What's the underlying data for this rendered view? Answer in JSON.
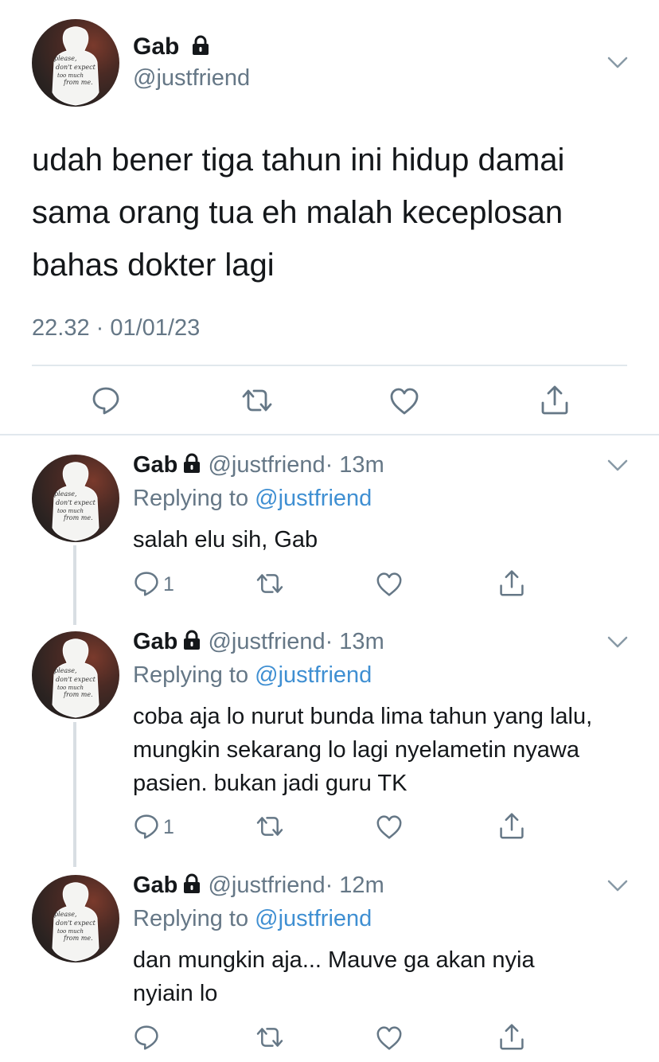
{
  "main_tweet": {
    "name": "Gab",
    "handle": "@justfriend",
    "text": "udah bener tiga tahun ini hidup damai sama orang tua eh malah keceplosan bahas dokter lagi",
    "timestamp": "22.32 · 01/01/23",
    "avatar_text": [
      "please,",
      "don't expect",
      "too much",
      "from me."
    ]
  },
  "replies": [
    {
      "name": "Gab",
      "handle": "@justfriend",
      "time": "· 13m",
      "replying_prefix": "Replying to ",
      "replying_to": "@justfriend",
      "text": "salah elu sih, Gab",
      "reply_count": "1"
    },
    {
      "name": "Gab",
      "handle": "@justfriend",
      "time": "· 13m",
      "replying_prefix": "Replying to ",
      "replying_to": "@justfriend",
      "text": "coba aja lo nurut bunda lima tahun yang lalu, mungkin sekarang lo lagi nyelametin nyawa pasien. bukan jadi guru TK",
      "reply_count": "1"
    },
    {
      "name": "Gab",
      "handle": "@justfriend",
      "time": "· 12m",
      "replying_prefix": "Replying to ",
      "replying_to": "@justfriend",
      "text": "dan mungkin aja... Mauve ga akan nyia nyiain lo",
      "reply_count": ""
    }
  ],
  "icons": {
    "lock": "lock-icon",
    "chevron": "chevron-down-icon",
    "reply": "reply-icon",
    "retweet": "retweet-icon",
    "like": "heart-icon",
    "share": "share-icon"
  },
  "colors": {
    "text": "#14171a",
    "secondary": "#657786",
    "mention": "#3f8fd2",
    "divider": "#e1e8ed"
  }
}
